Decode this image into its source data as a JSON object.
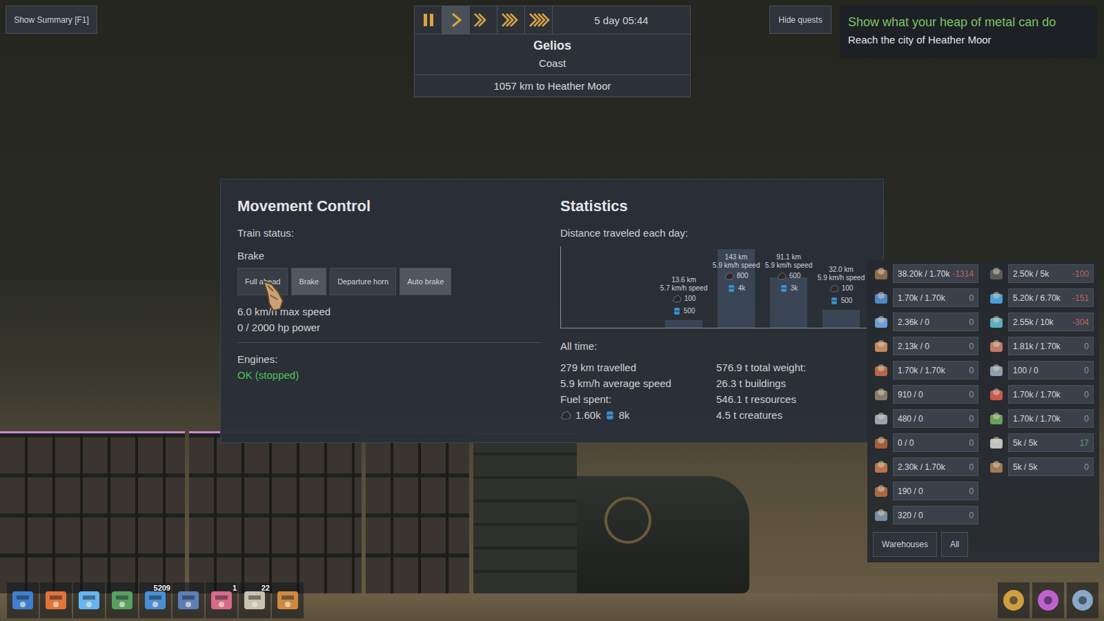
{
  "top_left_button": "Show Summary [F1]",
  "time_controls": {
    "buttons": [
      {
        "kind": "pause",
        "selected": false
      },
      {
        "kind": "play",
        "selected": true
      },
      {
        "kind": "fast",
        "selected": false
      },
      {
        "kind": "faster",
        "selected": false
      },
      {
        "kind": "fastest",
        "selected": false
      }
    ],
    "time": "5 day 05:44"
  },
  "location": {
    "name": "Gelios",
    "terrain": "Coast",
    "distance": "1057 km to Heather Moor"
  },
  "quest_toggle": "Hide quests",
  "quest": {
    "title": "Show what your heap of metal can do",
    "objective": "Reach the city of Heather Moor"
  },
  "movement": {
    "title": "Movement Control",
    "status_label": "Train status:",
    "status": "Brake",
    "buttons": [
      {
        "label": "Full ahead",
        "selected": false,
        "hovered": true
      },
      {
        "label": "Brake",
        "selected": true,
        "hovered": false
      },
      {
        "label": "Departure horn",
        "selected": false,
        "hovered": false
      },
      {
        "label": "Auto brake",
        "selected": true,
        "hovered": false
      }
    ],
    "max_speed": "6.0 km/h max speed",
    "power": "0 / 2000 hp power",
    "engines_label": "Engines:",
    "engines_status": "OK (stopped)"
  },
  "statistics": {
    "title": "Statistics",
    "chart": {
      "title": "Distance traveled each day:",
      "distance_km": [
        13.6,
        143,
        91.1,
        32.0
      ],
      "days": [
        {
          "distance": "13.6 km",
          "speed": "5.7 km/h speed",
          "coal": "100",
          "water": "500"
        },
        {
          "distance": "143 km",
          "speed": "5.9 km/h speed",
          "coal": "800",
          "water": "4k"
        },
        {
          "distance": "91.1 km",
          "speed": "5.9 km/h speed",
          "coal": "600",
          "water": "3k"
        },
        {
          "distance": "32.0 km",
          "speed": "5.9 km/h speed",
          "coal": "100",
          "water": "500"
        }
      ]
    },
    "all_time_label": "All time:",
    "travel": [
      "279 km travelled",
      "5.9 km/h average speed"
    ],
    "fuel_label": "Fuel spent:",
    "fuel": {
      "coal": "1.60k",
      "water": "8k"
    },
    "weight": [
      "576.9 t total weight:",
      "26.3 t buildings",
      "546.1 t resources",
      "4.5 t creatures"
    ]
  },
  "resources": {
    "columns": [
      [
        {
          "value": "38.20k / 1.70k",
          "delta": "-1314",
          "color": "#c0605e"
        },
        {
          "value": "1.70k / 1.70k",
          "delta": "0",
          "color": "#8f969d"
        },
        {
          "value": "2.36k / 0",
          "delta": "0",
          "color": "#8f969d"
        },
        {
          "value": "2.13k / 0",
          "delta": "0",
          "color": "#8f969d"
        },
        {
          "value": "1.70k / 1.70k",
          "delta": "0",
          "color": "#8f969d"
        },
        {
          "value": "910 / 0",
          "delta": "0",
          "color": "#8f969d"
        },
        {
          "value": "480 / 0",
          "delta": "0",
          "color": "#8f969d"
        },
        {
          "value": "0 / 0",
          "delta": "0",
          "color": "#8f969d"
        },
        {
          "value": "2.30k / 1.70k",
          "delta": "0",
          "color": "#8f969d"
        },
        {
          "value": "190 / 0",
          "delta": "0",
          "color": "#8f969d"
        },
        {
          "value": "320 / 0",
          "delta": "0",
          "color": "#8f969d"
        }
      ],
      [
        {
          "value": "2.50k / 5k",
          "delta": "-100",
          "color": "#c0605e"
        },
        {
          "value": "5.20k / 6.70k",
          "delta": "-151",
          "color": "#c0605e"
        },
        {
          "value": "2.55k / 10k",
          "delta": "-304",
          "color": "#c0605e"
        },
        {
          "value": "1.81k / 1.70k",
          "delta": "0",
          "color": "#8f969d"
        },
        {
          "value": "100 / 0",
          "delta": "0",
          "color": "#8f969d"
        },
        {
          "value": "1.70k / 1.70k",
          "delta": "0",
          "color": "#8f969d"
        },
        {
          "value": "1.70k / 1.70k",
          "delta": "0",
          "color": "#8f969d"
        },
        {
          "value": "5k / 5k",
          "delta": "17",
          "color": "#6a9a6e"
        },
        {
          "value": "5k / 5k",
          "delta": "0",
          "color": "#8f969d"
        }
      ]
    ],
    "buttons": [
      "Warehouses",
      "All"
    ]
  },
  "toolbar": [
    {},
    {},
    {},
    {},
    {
      "badge": "5209"
    },
    {},
    {
      "badge": "1"
    },
    {
      "badge": "22"
    },
    {}
  ],
  "toolbar_right": [
    {},
    {},
    {}
  ]
}
